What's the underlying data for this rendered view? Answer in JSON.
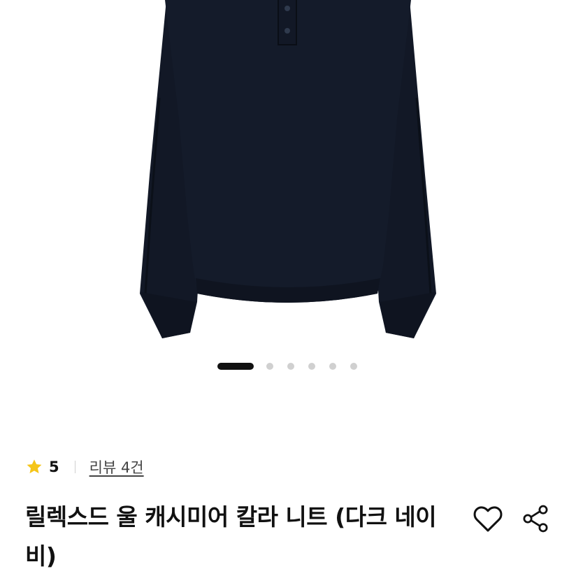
{
  "product": {
    "image_alt": "dark navy wool cashmere collar knit sweater",
    "carousel": {
      "total": 6,
      "active_index": 0
    },
    "rating": {
      "icon": "star-icon",
      "score": "5",
      "star_color": "#f5c518"
    },
    "review_link": "리뷰 4건",
    "title": "릴렉스드 울 캐시미어 칼라 니트 (다크 네이비)",
    "actions": {
      "like_icon": "heart-icon",
      "share_icon": "share-icon"
    }
  },
  "colors": {
    "sweater": "#111827",
    "dot_active": "#111111",
    "dot_inactive": "#d0d0d0"
  }
}
